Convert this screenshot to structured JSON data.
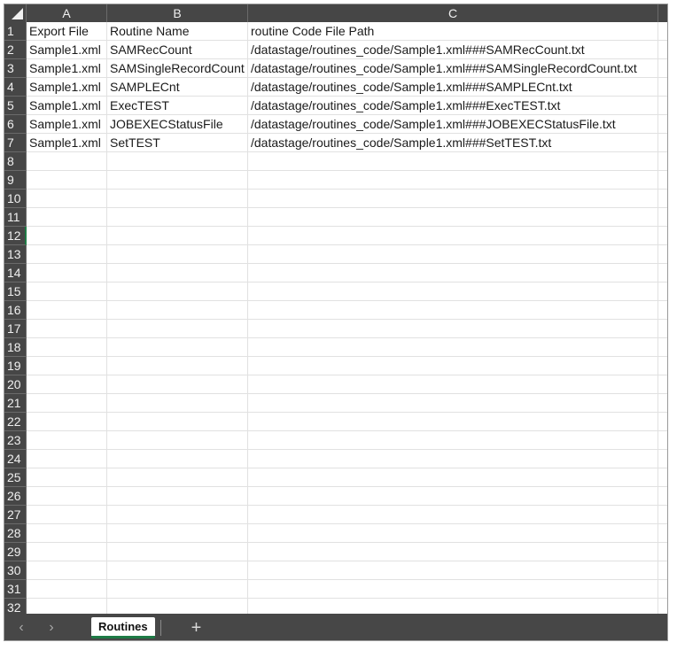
{
  "columns": [
    "A",
    "B",
    "C"
  ],
  "rows": [
    "1",
    "2",
    "3",
    "4",
    "5",
    "6",
    "7",
    "8",
    "9",
    "10",
    "11",
    "12",
    "13",
    "14",
    "15",
    "16",
    "17",
    "18",
    "19",
    "20",
    "21",
    "22",
    "23",
    "24",
    "25",
    "26",
    "27",
    "28",
    "29",
    "30",
    "31",
    "32"
  ],
  "cells": [
    [
      "Export File",
      "Routine Name",
      "routine Code File Path"
    ],
    [
      "Sample1.xml",
      "SAMRecCount",
      "/datastage/routines_code/Sample1.xml###SAMRecCount.txt"
    ],
    [
      "Sample1.xml",
      "SAMSingleRecordCount",
      "/datastage/routines_code/Sample1.xml###SAMSingleRecordCount.txt"
    ],
    [
      "Sample1.xml",
      "SAMPLECnt",
      "/datastage/routines_code/Sample1.xml###SAMPLECnt.txt"
    ],
    [
      "Sample1.xml",
      "ExecTEST",
      "/datastage/routines_code/Sample1.xml###ExecTEST.txt"
    ],
    [
      "Sample1.xml",
      "JOBEXECStatusFile",
      "/datastage/routines_code/Sample1.xml###JOBEXECStatusFile.txt"
    ],
    [
      "Sample1.xml",
      "SetTEST",
      "/datastage/routines_code/Sample1.xml###SetTEST.txt"
    ]
  ],
  "sheet_bar": {
    "prev": "‹",
    "next": "›",
    "active_tab": "Routines",
    "add": "+"
  },
  "selected_row": "12",
  "accent_color": "#1e7b45"
}
